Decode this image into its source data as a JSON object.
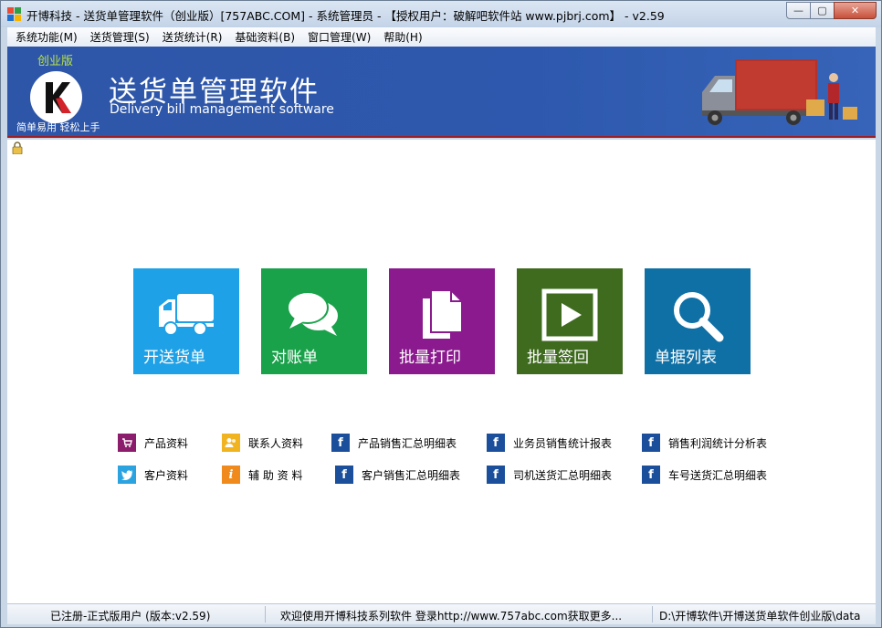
{
  "window": {
    "title": "开博科技 - 送货单管理软件（创业版）[757ABC.COM] - 系统管理员 - 【授权用户：破解吧软件站 www.pjbrj.com】 - v2.59",
    "controls": {
      "minimize": "—",
      "maximize": "▢",
      "close": "✕"
    }
  },
  "menu": [
    "系统功能(M)",
    "送货管理(S)",
    "送货统计(R)",
    "基础资料(B)",
    "窗口管理(W)",
    "帮助(H)"
  ],
  "banner": {
    "edition": "创业版",
    "slogan": "简单易用 轻松上手",
    "title": "送货单管理软件",
    "subtitle": "Delivery bill management software",
    "brand_color": "#2e56a8"
  },
  "tiles": [
    {
      "label": "开送货单",
      "icon": "truck-icon",
      "color": "#1ea1e6"
    },
    {
      "label": "对账单",
      "icon": "chat-icon",
      "color": "#1aa24b"
    },
    {
      "label": "批量打印",
      "icon": "copy-icon",
      "color": "#8b1a8e"
    },
    {
      "label": "批量签回",
      "icon": "play-icon",
      "color": "#3f6b1f"
    },
    {
      "label": "单据列表",
      "icon": "search-icon",
      "color": "#0f70a6"
    }
  ],
  "links": [
    {
      "label": "产品资料",
      "icon": "cart-icon",
      "color": "#8c1c6c",
      "glyph": "🛒"
    },
    {
      "label": "联系人资料",
      "icon": "contacts-icon",
      "color": "#f2b320",
      "glyph": "👥"
    },
    {
      "label": "产品销售汇总明细表",
      "icon": "f-icon",
      "color": "#1b4f9c",
      "glyph": "f"
    },
    {
      "label": "业务员销售统计报表",
      "icon": "f-icon",
      "color": "#1b4f9c",
      "glyph": "f"
    },
    {
      "label": "销售利润统计分析表",
      "icon": "f-icon",
      "color": "#1b4f9c",
      "glyph": "f"
    },
    {
      "label": "客户资料",
      "icon": "bird-icon",
      "color": "#2aa3e0",
      "glyph": "🐦"
    },
    {
      "label": "辅 助 资 料",
      "icon": "info-icon",
      "color": "#f08a1c",
      "glyph": "i"
    },
    {
      "label": "客户销售汇总明细表",
      "icon": "f-icon",
      "color": "#1b4f9c",
      "glyph": "f"
    },
    {
      "label": "司机送货汇总明细表",
      "icon": "f-icon",
      "color": "#1b4f9c",
      "glyph": "f"
    },
    {
      "label": "车号送货汇总明细表",
      "icon": "f-icon",
      "color": "#1b4f9c",
      "glyph": "f"
    }
  ],
  "status": {
    "registration": "已注册-正式版用户 (版本:v2.59)",
    "welcome": "欢迎使用开博科技系列软件   登录http://www.757abc.com获取更多...",
    "path": "D:\\开博软件\\开博送货单软件创业版\\data"
  }
}
